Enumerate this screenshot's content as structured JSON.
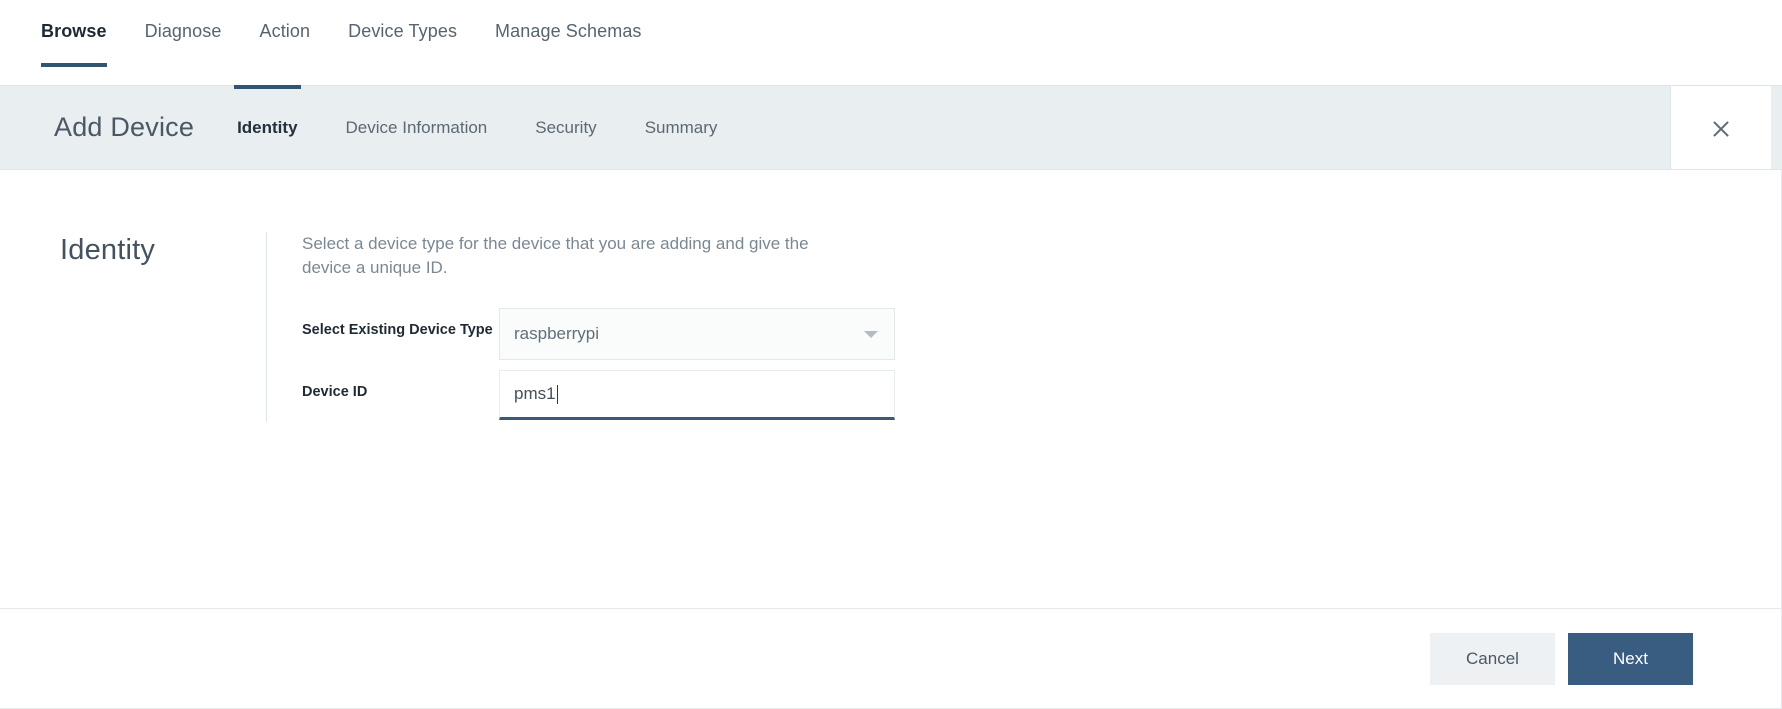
{
  "topnav": {
    "items": [
      {
        "label": "Browse",
        "active": true
      },
      {
        "label": "Diagnose",
        "active": false
      },
      {
        "label": "Action",
        "active": false
      },
      {
        "label": "Device Types",
        "active": false
      },
      {
        "label": "Manage Schemas",
        "active": false
      }
    ]
  },
  "wizard": {
    "title": "Add Device",
    "steps": [
      {
        "label": "Identity",
        "active": true
      },
      {
        "label": "Device Information",
        "active": false
      },
      {
        "label": "Security",
        "active": false
      },
      {
        "label": "Summary",
        "active": false
      }
    ],
    "close_icon": "close-icon"
  },
  "main": {
    "section_title": "Identity",
    "description": "Select a device type for the device that you are adding and give the device a unique ID.",
    "fields": [
      {
        "label": "Select Existing Device Type",
        "type": "select",
        "value": "raspberrypi",
        "caret_icon": "chevron-down-icon"
      },
      {
        "label": "Device ID",
        "type": "text",
        "value": "pms1",
        "placeholder": "",
        "focused": true
      }
    ]
  },
  "footer": {
    "cancel_label": "Cancel",
    "next_label": "Next"
  },
  "colors": {
    "accent": "#2f5572",
    "primary_button": "#395d80",
    "header_bar": "#e9eef1",
    "cancel_button": "#eef1f3",
    "input_focus_underline": "#3a5a78"
  }
}
